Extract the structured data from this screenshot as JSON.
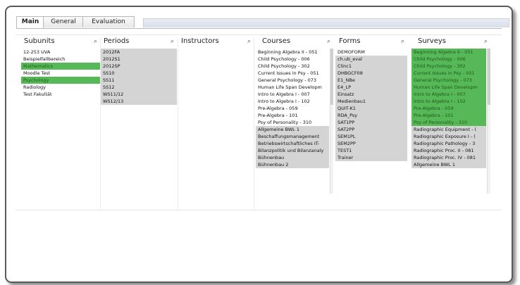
{
  "tabs": [
    "Main",
    "General",
    "Evaluation"
  ],
  "listboxes": {
    "subunits": {
      "title": "Subunits",
      "rows": [
        {
          "text": "12-253 UVA",
          "state": "poss"
        },
        {
          "text": "Beispielfallbereich",
          "state": "poss"
        },
        {
          "text": "Mathematics",
          "state": "sel"
        },
        {
          "text": "Moodle Test",
          "state": "poss"
        },
        {
          "text": "Psychology",
          "state": "sel"
        },
        {
          "text": "Radiology",
          "state": "poss"
        },
        {
          "text": "Test Fakultät",
          "state": "poss"
        }
      ]
    },
    "periods": {
      "title": "Periods",
      "rows": [
        {
          "text": "2012FA",
          "state": "excl"
        },
        {
          "text": "2012S1",
          "state": "excl"
        },
        {
          "text": "2012SP",
          "state": "excl"
        },
        {
          "text": "SS10",
          "state": "excl"
        },
        {
          "text": "SS11",
          "state": "excl"
        },
        {
          "text": "SS12",
          "state": "excl"
        },
        {
          "text": "WS11/12",
          "state": "excl"
        },
        {
          "text": "WS12/13",
          "state": "excl"
        }
      ]
    },
    "instructors": {
      "title": "Instructors",
      "rows": []
    },
    "courses": {
      "title": "Courses",
      "rows": [
        {
          "text": "Beginning Algebra II - 051",
          "state": "poss"
        },
        {
          "text": "Child Psychology - 006",
          "state": "poss"
        },
        {
          "text": "Child Psychology - 302",
          "state": "poss"
        },
        {
          "text": "Current Issues in Psy - 051",
          "state": "poss"
        },
        {
          "text": "General Psychology - 073",
          "state": "poss"
        },
        {
          "text": "Human Life Span Developm",
          "state": "poss"
        },
        {
          "text": "Intro to Algebra I - 007",
          "state": "poss"
        },
        {
          "text": "Intro to Algebra I - 102",
          "state": "poss"
        },
        {
          "text": "Pre-Algebra - 059",
          "state": "poss"
        },
        {
          "text": "Pre-Algebra - 101",
          "state": "poss"
        },
        {
          "text": "Psy of Personality - 310",
          "state": "poss"
        },
        {
          "text": "Allgemeine BWL 1",
          "state": "excl"
        },
        {
          "text": "Beschaffungsmanagement",
          "state": "excl"
        },
        {
          "text": "Betriebswirtschaftliches IT-",
          "state": "excl"
        },
        {
          "text": "Bilanzpolitik und Bilanzanaly",
          "state": "excl"
        },
        {
          "text": "Bühnenbau",
          "state": "excl"
        },
        {
          "text": "Bühnenbau 2",
          "state": "excl"
        }
      ]
    },
    "forms": {
      "title": "Forms",
      "rows": [
        {
          "text": "DEMOFORM",
          "state": "poss"
        },
        {
          "text": "ch.ub_eval",
          "state": "excl"
        },
        {
          "text": "Clinc1",
          "state": "excl"
        },
        {
          "text": "DHBGCF08",
          "state": "excl"
        },
        {
          "text": "E1_NBe",
          "state": "excl"
        },
        {
          "text": "E4_LP",
          "state": "excl"
        },
        {
          "text": "Einsatz",
          "state": "excl"
        },
        {
          "text": "Medienbau1",
          "state": "excl"
        },
        {
          "text": "QUIT-K1",
          "state": "excl"
        },
        {
          "text": "RDA_Psy",
          "state": "excl"
        },
        {
          "text": "SAT1PP",
          "state": "excl"
        },
        {
          "text": "SAT2PP",
          "state": "excl"
        },
        {
          "text": "SEM1PL",
          "state": "excl"
        },
        {
          "text": "SEM2PP",
          "state": "excl"
        },
        {
          "text": "TEST1",
          "state": "excl"
        },
        {
          "text": "Trainer",
          "state": "excl"
        }
      ]
    },
    "surveys": {
      "title": "Surveys",
      "rows": [
        {
          "text": "Beginning Algebra II - 051",
          "state": "sel"
        },
        {
          "text": "Child Psychology - 006",
          "state": "sel"
        },
        {
          "text": "Child Psychology - 302",
          "state": "sel"
        },
        {
          "text": "Current Issues in Psy - 051",
          "state": "sel"
        },
        {
          "text": "General Psychology - 073",
          "state": "sel"
        },
        {
          "text": "Human Life Span Developm",
          "state": "sel"
        },
        {
          "text": "Intro to Algebra I - 007",
          "state": "sel"
        },
        {
          "text": "Intro to Algebra I - 102",
          "state": "sel"
        },
        {
          "text": "Pre-Algebra - 059",
          "state": "sel"
        },
        {
          "text": "Pre-Algebra - 101",
          "state": "sel"
        },
        {
          "text": "Psy of Personality - 310",
          "state": "sel"
        },
        {
          "text": "Radiographic Equipment - (",
          "state": "excl"
        },
        {
          "text": "Radiographic Exposure I - (",
          "state": "excl"
        },
        {
          "text": "Radiographic Pathology - 3",
          "state": "excl"
        },
        {
          "text": "Radiographic Proc. II - 081",
          "state": "excl"
        },
        {
          "text": "Radiographic Proc. IV - 081",
          "state": "excl"
        },
        {
          "text": "Allgemeine BWL 1",
          "state": "excl"
        }
      ]
    }
  }
}
